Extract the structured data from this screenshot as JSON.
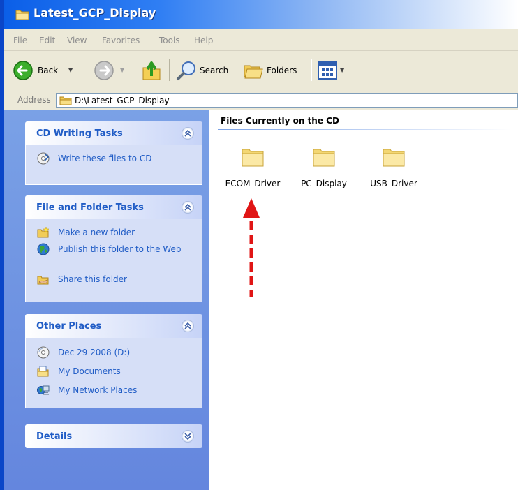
{
  "window": {
    "title": "Latest_GCP_Display"
  },
  "menubar": {
    "items": [
      "File",
      "Edit",
      "View",
      "Favorites",
      "Tools",
      "Help"
    ]
  },
  "toolbar": {
    "back_label": "Back",
    "search_label": "Search",
    "folders_label": "Folders"
  },
  "address": {
    "label": "Address",
    "value": "D:\\Latest_GCP_Display"
  },
  "taskpane": {
    "cd_writing": {
      "title": "CD Writing Tasks",
      "items": [
        {
          "label": "Write these files to CD",
          "icon": "cd-write-icon"
        }
      ]
    },
    "file_folder": {
      "title": "File and Folder Tasks",
      "items": [
        {
          "label": "Make a new folder",
          "icon": "new-folder-icon"
        },
        {
          "label": "Publish this folder to the Web",
          "icon": "publish-web-icon"
        },
        {
          "label": "Share this folder",
          "icon": "share-folder-icon"
        }
      ]
    },
    "other_places": {
      "title": "Other Places",
      "items": [
        {
          "label": "Dec 29 2008 (D:)",
          "icon": "cd-drive-icon"
        },
        {
          "label": "My Documents",
          "icon": "my-documents-icon"
        },
        {
          "label": "My Network Places",
          "icon": "network-places-icon"
        }
      ]
    },
    "details": {
      "title": "Details"
    }
  },
  "content": {
    "group_title": "Files Currently on the CD",
    "folders": [
      {
        "name": "ECOM_Driver"
      },
      {
        "name": "PC_Display"
      },
      {
        "name": "USB_Driver"
      }
    ]
  },
  "colors": {
    "title_blue": "#0b5fe8",
    "task_link": "#215dc6",
    "pane_blue": "#6f94e2",
    "arrow_red": "#e01515",
    "folder_yellow": "#f8dc7a"
  }
}
